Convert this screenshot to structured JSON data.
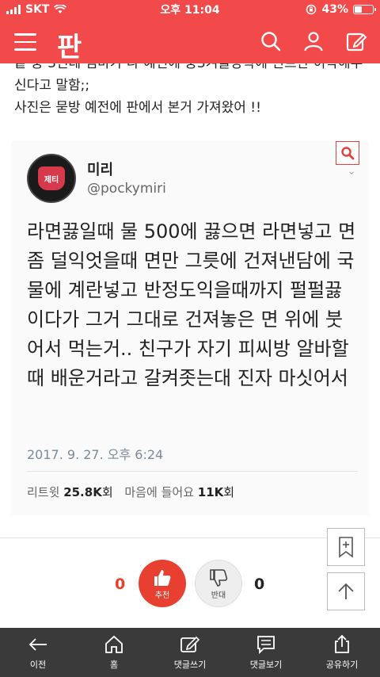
{
  "status_bar": {
    "carrier": "SKT",
    "time": "오후 11:04",
    "battery": "43%",
    "battery_level": 0.43
  },
  "header": {
    "logo": "판",
    "colors": {
      "brand": "#f24a4a"
    }
  },
  "article": {
    "cut_line": "끝 중 3인데 엄마가 나 예전에 중3겨울방학에 린트만 허락해주",
    "line1": "신다고 말함;;",
    "line2": "사진은 묻방 예전에 판에서 본거 가져왔어 !!"
  },
  "tweet": {
    "name": "미리",
    "handle": "@pockymiri",
    "avatar_text": "제티",
    "body": "라면끓일때 물 500에 끓으면 라면넣고 면 좀 덜익엇을때 면만 그릇에 건져낸담에 국물에 계란넣고 반정도익을때까지 펄펄끓이다가 그거 그대로 건져놓은 면 위에 붓어서 먹는거.. 친구가 자기 피씨방 알바할때 배운거라고 갈켜좃는대 진자 마싯어서",
    "date": "2017. 9. 27. 오후 6:24",
    "retweet_label": "리트윗",
    "retweet_count": "25.8K",
    "retweet_unit": "회",
    "like_label": "마음에 들어요",
    "like_count": "11K",
    "like_unit": "회"
  },
  "votes": {
    "up_label": "추천",
    "up_count": "0",
    "down_label": "반대",
    "down_count": "0"
  },
  "tabbar": [
    {
      "label": "이전",
      "icon": "back-arrow-icon"
    },
    {
      "label": "홈",
      "icon": "home-icon"
    },
    {
      "label": "댓글쓰기",
      "icon": "write-comment-icon"
    },
    {
      "label": "댓글보기",
      "icon": "view-comments-icon"
    },
    {
      "label": "공유하기",
      "icon": "share-icon"
    }
  ]
}
